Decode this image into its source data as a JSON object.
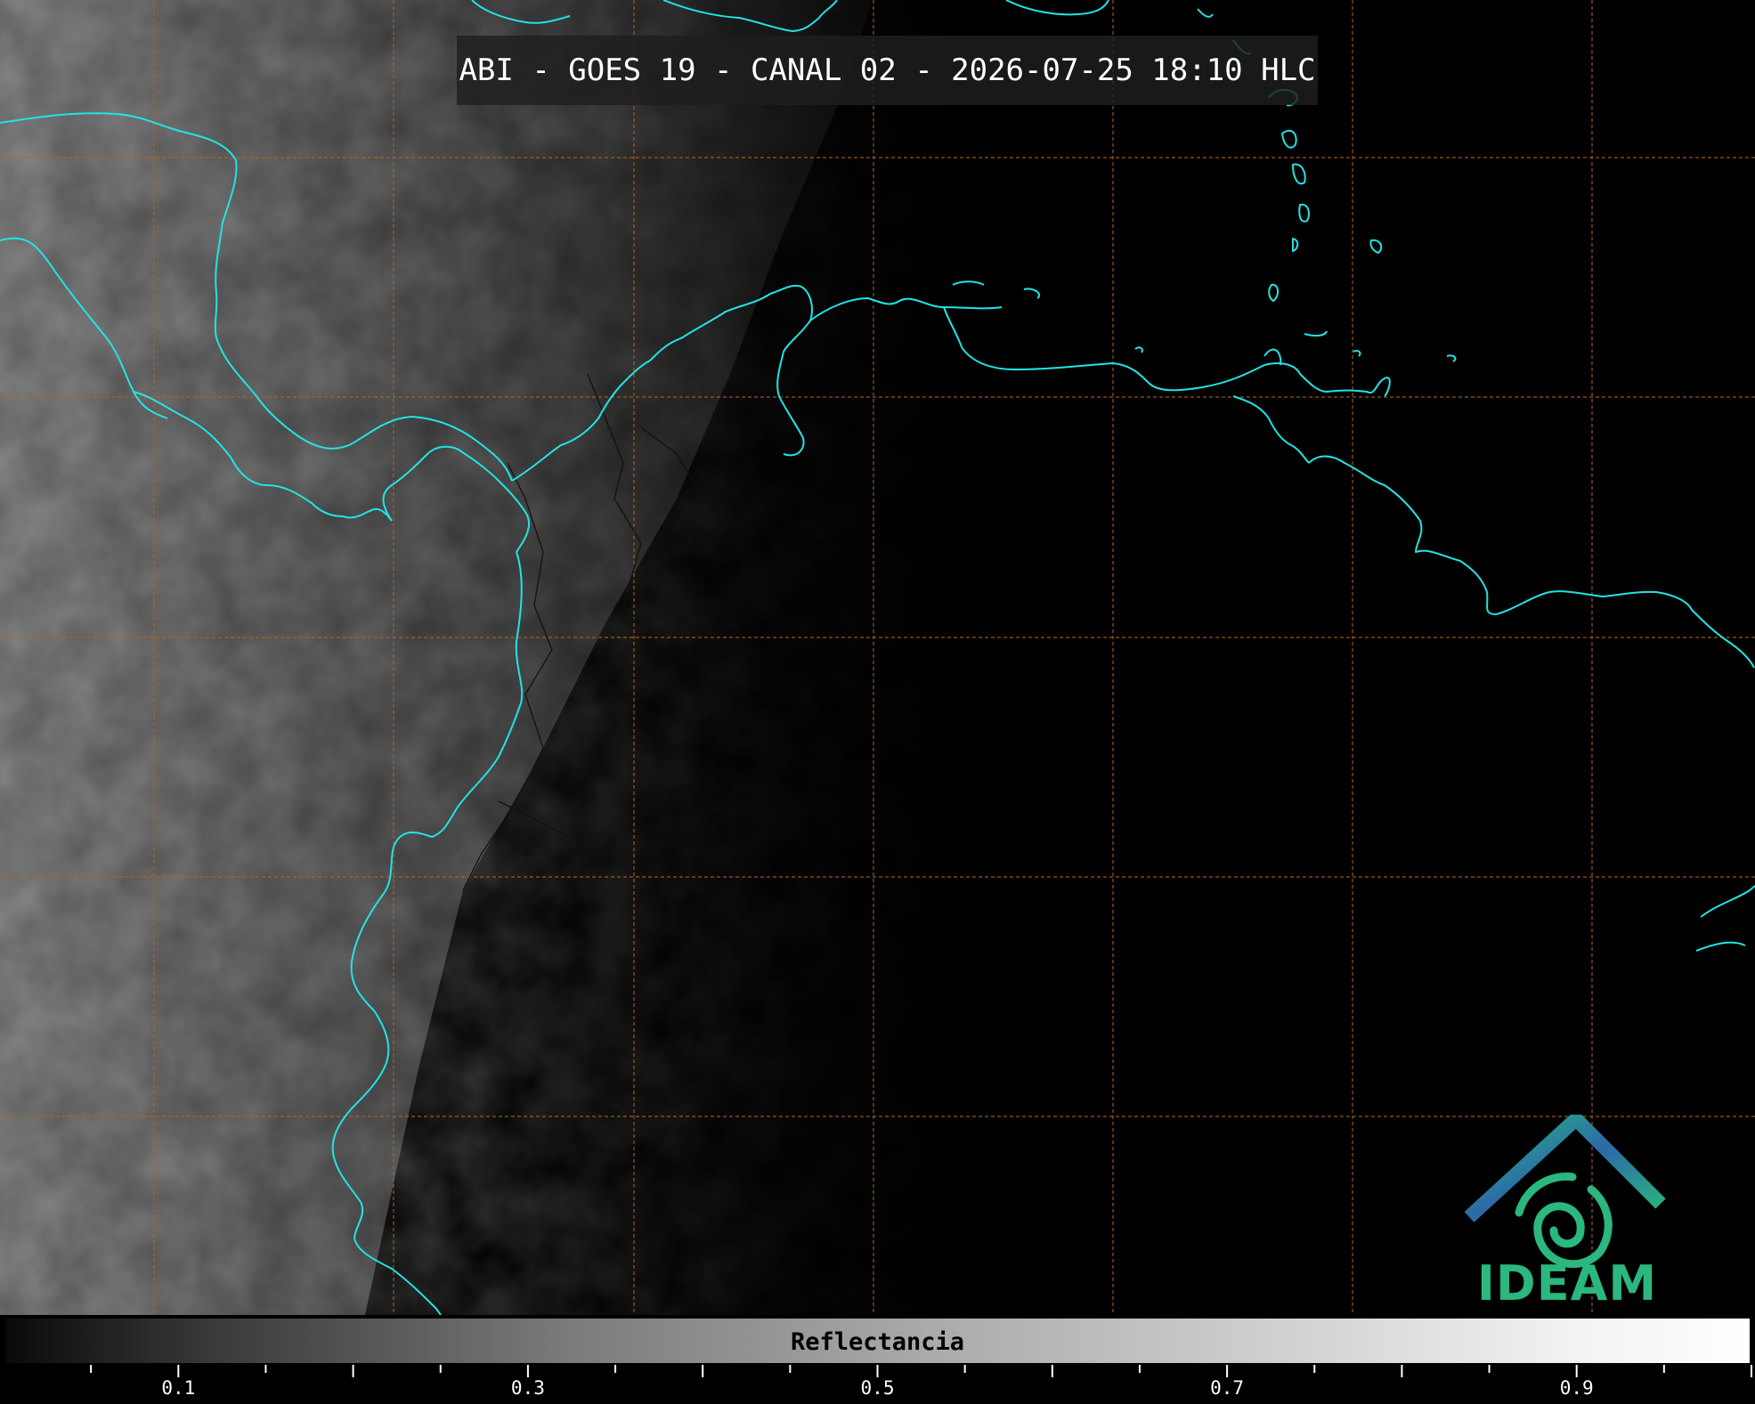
{
  "title": "ABI - GOES 19 - CANAL 02 - 2026-07-25 18:10 HLC",
  "logo": {
    "name": "IDEAM",
    "color": "#2bb77d",
    "roof_color": "#2b6aa8"
  },
  "colorbar": {
    "label": "Reflectancia",
    "min": 0.0,
    "max": 1.0,
    "ticks": [
      "0.1",
      "0.3",
      "0.5",
      "0.7",
      "0.9"
    ],
    "tick_values": [
      0.1,
      0.3,
      0.5,
      0.7,
      0.9
    ]
  },
  "colors": {
    "coastline": "#22e4e4",
    "gridline": "#b5651d",
    "borders": "#111111",
    "background": "#000000"
  }
}
